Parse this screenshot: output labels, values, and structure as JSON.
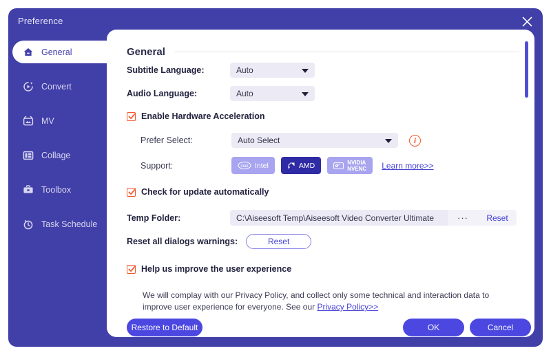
{
  "window": {
    "title": "Preference",
    "close_label": "close-icon"
  },
  "sidebar": {
    "items": [
      {
        "label": "General",
        "icon": "home-icon",
        "active": true
      },
      {
        "label": "Convert",
        "icon": "play-circle-icon",
        "active": false
      },
      {
        "label": "MV",
        "icon": "video-icon",
        "active": false
      },
      {
        "label": "Collage",
        "icon": "layout-icon",
        "active": false
      },
      {
        "label": "Toolbox",
        "icon": "briefcase-icon",
        "active": false
      },
      {
        "label": "Task Schedule",
        "icon": "clock-icon",
        "active": false
      }
    ]
  },
  "main": {
    "section_title": "General",
    "subtitle_language": {
      "label": "Subtitle Language:",
      "value": "Auto"
    },
    "audio_language": {
      "label": "Audio Language:",
      "value": "Auto"
    },
    "hardware_acceleration": {
      "label": "Enable Hardware Acceleration",
      "checked": true
    },
    "prefer_select": {
      "label": "Prefer Select:",
      "value": "Auto Select",
      "info_glyph": "i"
    },
    "support": {
      "label": "Support:",
      "chips": [
        {
          "label": "Intel",
          "state": "idle"
        },
        {
          "label": "AMD",
          "state": "selected"
        },
        {
          "label": "NVIDIA NVENC",
          "state": "idle"
        }
      ],
      "learn_more": "Learn more>>"
    },
    "check_update": {
      "label": "Check for update automatically",
      "checked": true
    },
    "temp_folder": {
      "label": "Temp Folder:",
      "value": "C:\\Aiseesoft Temp\\Aiseesoft Video Converter Ultimate",
      "browse_label": "···",
      "reset_label": "Reset"
    },
    "reset_dialogs": {
      "label": "Reset all dialogs warnings:",
      "button_label": "Reset"
    },
    "improve_experience": {
      "label": "Help us improve the user experience",
      "checked": true,
      "description_before": "We will complay with our Privacy Policy, and collect only some technical and interaction data to improve user experience for everyone. See our ",
      "link_label": "Privacy Policy>>"
    }
  },
  "footer": {
    "restore_label": "Restore to Default",
    "ok_label": "OK",
    "cancel_label": "Cancel"
  },
  "colors": {
    "window_purple": "#413fa8",
    "accent_purple": "#4b47e0",
    "chip_selected": "#2e2ba4",
    "chip_idle": "#a8a4ef",
    "checkbox_orange": "#f2562a",
    "field_grey": "#eceaf4"
  }
}
